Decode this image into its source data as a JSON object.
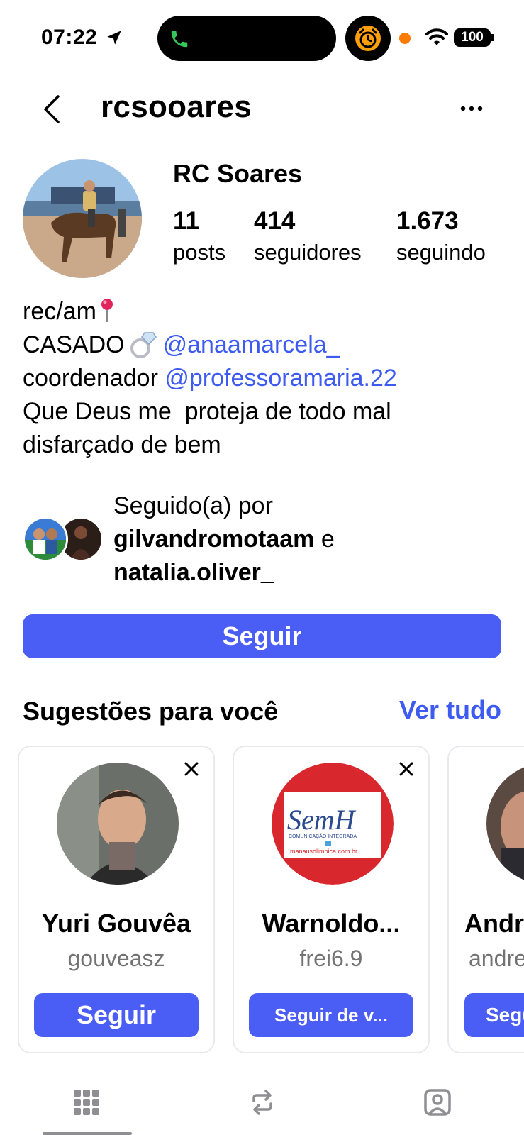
{
  "status_bar": {
    "time": "07:22",
    "battery": "100",
    "call_indicator_color": "#34c759",
    "alarm_color": "#ff9f0a"
  },
  "header": {
    "username": "rcsooares"
  },
  "profile": {
    "display_name": "RC Soares",
    "stats": {
      "posts_count": "11",
      "posts_label": "posts",
      "followers_count": "414",
      "followers_label": "seguidores",
      "following_count": "1.673",
      "following_label": "seguindo"
    },
    "bio": {
      "line1": "rec/am",
      "line2_text": "CASADO",
      "line2_mention": "@anaamarcela_",
      "line3_text": "coordenador",
      "line3_mention": "@professoramaria.22",
      "line4": "Que Deus me  proteja de todo mal",
      "line5": "disfarçado de bem"
    },
    "followed_by": {
      "prefix": "Seguido(a) por",
      "user1": "gilvandromotaam",
      "conjunction": "e",
      "user2": "natalia.oliver_"
    },
    "follow_button": "Seguir"
  },
  "suggestions": {
    "title": "Sugestões para você",
    "see_all": "Ver tudo",
    "cards": [
      {
        "name": "Yuri Gouvêa",
        "handle": "gouveasz",
        "button": "Seguir"
      },
      {
        "name": "Warnoldo...",
        "handle": "frei6.9",
        "button": "Seguir de v...",
        "logo_text": "SemH",
        "logo_subtitle": "COMUNICAÇÃO INTEGRADA",
        "logo_url": "manausolimpica.com.br"
      },
      {
        "name": "Andr",
        "handle": "andre",
        "button": "Segu"
      }
    ]
  },
  "accent_color": "#4a5df5",
  "link_color": "#3d5af1"
}
